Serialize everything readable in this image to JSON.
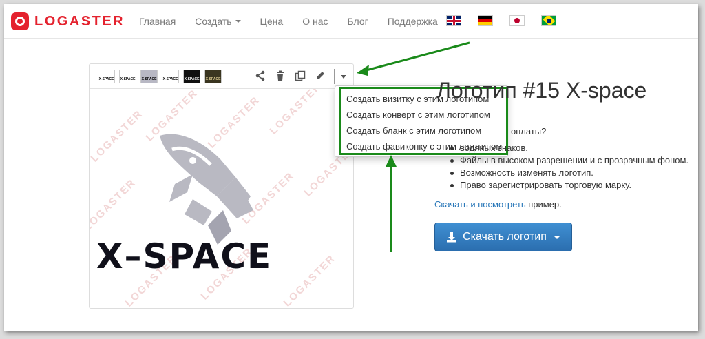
{
  "brand": {
    "name": "LOGASTER"
  },
  "nav": {
    "items": [
      "Главная",
      "Создать",
      "Цена",
      "О нас",
      "Блог",
      "Поддержка"
    ],
    "flags": [
      "flag-gb-icon",
      "flag-de-icon",
      "flag-jp-icon",
      "flag-br-icon"
    ]
  },
  "panel": {
    "thumbnails": [
      "X-SPACE",
      "X-SPACE",
      "X-SPACE",
      "X-SPACE",
      "X-SPACE",
      "X-SPACE"
    ],
    "tools": [
      "share-icon",
      "trash-icon",
      "copy-icon",
      "pencil-icon"
    ],
    "logo_text": "X–SPACE",
    "watermark": "LOGASTER"
  },
  "menu": {
    "items": [
      "Создать визитку с этим логотипом",
      "Создать конверт с этим логотипом",
      "Создать бланк с этим логотипом",
      "Создать фавиконку с этим логотипом"
    ]
  },
  "info": {
    "title": "Логотип #15 X-space",
    "question": "оплаты?",
    "benefits": [
      "водяных знаков.",
      "Файлы в высоком разрешении и с прозрачным фоном.",
      "Возможность изменять логотип.",
      "Право зарегистрировать торговую марку."
    ],
    "example_link": "Скачать и посмотреть",
    "example_suffix": " пример.",
    "download_label": "Скачать логотип"
  },
  "colors": {
    "brand": "#e4222e",
    "annotation": "#1a8a1a",
    "button": "#337ab7",
    "link": "#2a78b9"
  }
}
